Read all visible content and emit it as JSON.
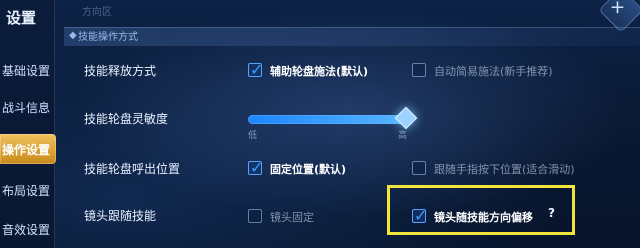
{
  "app": {
    "title": "设置",
    "close_icon": "close-icon"
  },
  "sidebar": {
    "items": [
      {
        "label": "基础设置",
        "active": false
      },
      {
        "label": "战斗信息",
        "active": false
      },
      {
        "label": "操作设置",
        "active": true
      },
      {
        "label": "布局设置",
        "active": false
      },
      {
        "label": "音效设置",
        "active": false
      }
    ]
  },
  "header": {
    "faded_tab": "方向区"
  },
  "section": {
    "title": "技能操作方式",
    "icon": "diamond-icon"
  },
  "rows": {
    "cast_mode": {
      "label": "技能释放方式",
      "options": [
        {
          "label": "辅助轮盘施法(默认)",
          "checked": true
        },
        {
          "label": "自动简易施法(新手推荐)",
          "checked": false
        }
      ]
    },
    "sensitivity": {
      "label": "技能轮盘灵敏度",
      "min_label": "低",
      "max_label": "高",
      "value_fraction": 0.95
    },
    "wheel_position": {
      "label": "技能轮盘呼出位置",
      "options": [
        {
          "label": "固定位置(默认)",
          "checked": true
        },
        {
          "label": "跟随手指按下位置(适合滑动)",
          "checked": false
        }
      ]
    },
    "camera_follow": {
      "label": "镜头跟随技能",
      "options": [
        {
          "label": "镜头固定",
          "checked": false
        },
        {
          "label": "镜头随技能方向偏移",
          "checked": true
        }
      ],
      "help": "?"
    }
  },
  "colors": {
    "accent_blue": "#2f8cff",
    "highlight_yellow": "#f2e43a",
    "active_tab": "#d99a2a"
  }
}
